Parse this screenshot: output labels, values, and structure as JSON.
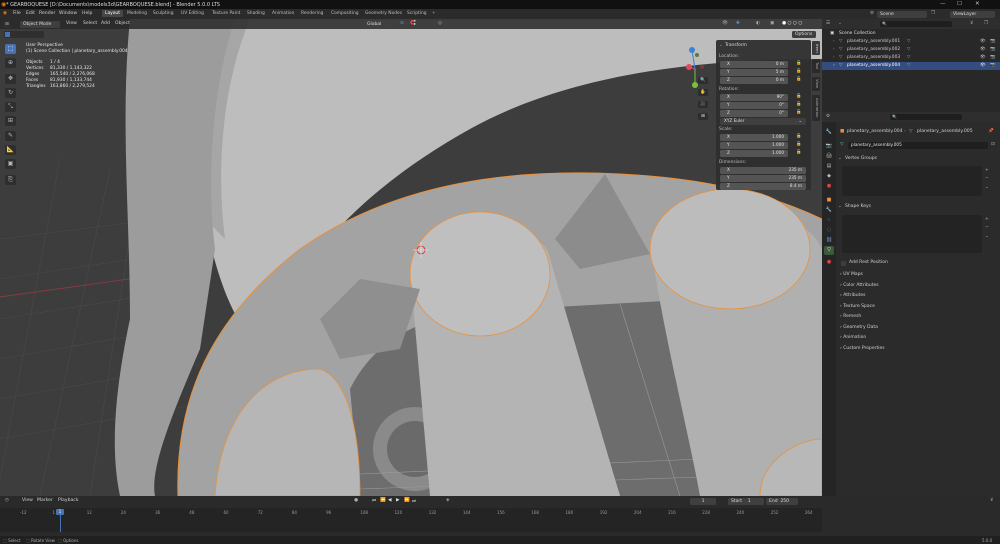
{
  "window": {
    "title": "* GEARBOQUESE [D:\\Documents\\models3d\\GEARBOQUESE.blend] - Blender 5.0.0 LTS",
    "controls": [
      "—",
      "☐",
      "✕"
    ]
  },
  "menu": [
    "File",
    "Edit",
    "Render",
    "Window",
    "Help"
  ],
  "workspaces": [
    {
      "label": "Layout",
      "active": true
    },
    {
      "label": "Modeling"
    },
    {
      "label": "Sculpting"
    },
    {
      "label": "UV Editing"
    },
    {
      "label": "Texture Paint"
    },
    {
      "label": "Shading"
    },
    {
      "label": "Animation"
    },
    {
      "label": "Rendering"
    },
    {
      "label": "Compositing"
    },
    {
      "label": "Geometry Nodes"
    },
    {
      "label": "Scripting"
    }
  ],
  "top_right": {
    "scene": "Scene",
    "view_layer": "ViewLayer"
  },
  "viewport_header": {
    "mode": "Object Mode",
    "menus": [
      "View",
      "Select",
      "Add",
      "Object"
    ],
    "orientation": "Global",
    "options": "Options"
  },
  "overlay_info": {
    "view": "User Perspective",
    "collection": "(1) Scene Collection | planetary_assembly.004",
    "stats": [
      {
        "label": "Objects",
        "value": "1 / 4"
      },
      {
        "label": "Vertices",
        "value": "81,330 / 1,143,322"
      },
      {
        "label": "Edges",
        "value": "165,540 / 2,276,068"
      },
      {
        "label": "Faces",
        "value": "81,930 / 1,133,744"
      },
      {
        "label": "Triangles",
        "value": "163,860 / 2,279,524"
      }
    ]
  },
  "n_panel": {
    "header": "Transform",
    "location_label": "Location:",
    "location": [
      {
        "axis": "X",
        "value": "0 m"
      },
      {
        "axis": "Y",
        "value": "5 m"
      },
      {
        "axis": "Z",
        "value": "0 m"
      }
    ],
    "rotation_label": "Rotation:",
    "rotation": [
      {
        "axis": "X",
        "value": "90°"
      },
      {
        "axis": "Y",
        "value": "0°"
      },
      {
        "axis": "Z",
        "value": "0°"
      }
    ],
    "rotation_mode": "XYZ Euler",
    "scale_label": "Scale:",
    "scale": [
      {
        "axis": "X",
        "value": "1.000"
      },
      {
        "axis": "Y",
        "value": "1.000"
      },
      {
        "axis": "Z",
        "value": "1.000"
      }
    ],
    "dimensions_label": "Dimensions:",
    "dimensions": [
      {
        "axis": "X",
        "value": "235 m"
      },
      {
        "axis": "Y",
        "value": "235 m"
      },
      {
        "axis": "Z",
        "value": "8.4 m"
      }
    ],
    "side_tabs": [
      "Item",
      "Tool",
      "View",
      "Animation"
    ]
  },
  "outliner": {
    "search_placeholder": "",
    "root": "Scene Collection",
    "items": [
      {
        "name": "planetary_assembly.001",
        "selected": false
      },
      {
        "name": "planetary_assembly.002",
        "selected": false
      },
      {
        "name": "planetary_assembly.003",
        "selected": false
      },
      {
        "name": "planetary_assembly.004",
        "selected": true
      }
    ]
  },
  "properties": {
    "breadcrumb_object": "planetary_assembly.004",
    "breadcrumb_mesh": "planetary_assembly.005",
    "mesh_name": "planetary_assembly.005",
    "vertex_groups": "Vertex Groups",
    "shape_keys": "Shape Keys",
    "add_rest_position": "Add Rest Position",
    "sections": [
      "UV Maps",
      "Color Attributes",
      "Attributes",
      "Texture Space",
      "Remesh",
      "Geometry Data",
      "Animation",
      "Custom Properties"
    ]
  },
  "timeline": {
    "menus": [
      "View",
      "Marker",
      "Playback"
    ],
    "current_frame": "1",
    "start_label": "Start",
    "start": "1",
    "end_label": "End",
    "end": "250",
    "ticks": [
      "-12",
      "1",
      "12",
      "24",
      "36",
      "48",
      "60",
      "72",
      "84",
      "96",
      "108",
      "120",
      "132",
      "144",
      "156",
      "168",
      "180",
      "192",
      "204",
      "216",
      "228",
      "240",
      "252",
      "264"
    ]
  },
  "status": {
    "items": [
      "Select",
      "Rotate View",
      "Options"
    ],
    "version": "5.0.0"
  },
  "colors": {
    "selection": "#e8913a",
    "active_tool": "#4772b3",
    "axis_x": "#e04a5a",
    "axis_y": "#7ac23a",
    "axis_z": "#3c83d6"
  }
}
